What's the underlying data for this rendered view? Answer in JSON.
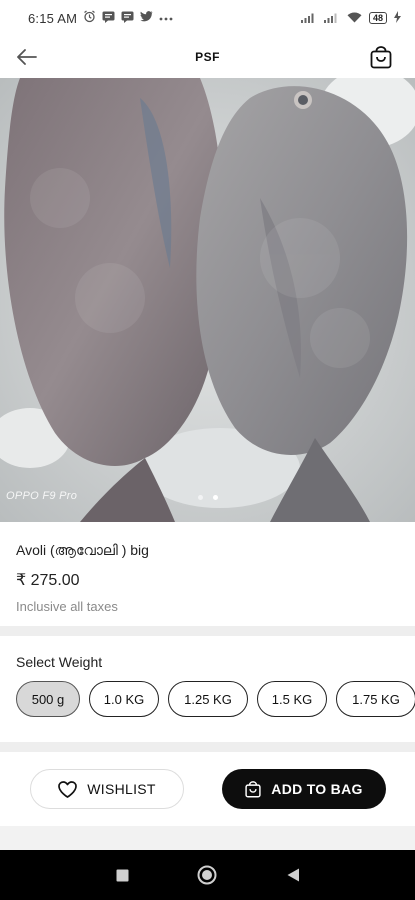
{
  "status_bar": {
    "time": "6:15 AM",
    "notification_icons": [
      "alarm-icon",
      "message-icon",
      "message-icon",
      "twitter-icon",
      "more-dots-icon"
    ],
    "battery_level": "48"
  },
  "header": {
    "title": "PSF"
  },
  "product_image": {
    "watermark": "OPPO F9 Pro",
    "carousel": {
      "total": 2,
      "active_index": 1
    }
  },
  "product": {
    "name": "Avoli (ആവോലി ) big",
    "price": "₹ 275.00",
    "tax_note": "Inclusive all taxes"
  },
  "weight": {
    "title": "Select Weight",
    "options": [
      "500 g",
      "1.0 KG",
      "1.25 KG",
      "1.5 KG",
      "1.75 KG"
    ],
    "selected": "500 g"
  },
  "actions": {
    "wishlist_label": "WISHLIST",
    "add_to_bag_label": "ADD TO BAG"
  },
  "nav": {
    "buttons": [
      "recents-square-icon",
      "home-circle-icon",
      "back-triangle-icon"
    ]
  },
  "colors": {
    "primary_button": "#0d0d0d",
    "selected_chip": "#d8d8d8",
    "section_gap": "#eeeeee",
    "muted_text": "#8a8a8a"
  }
}
